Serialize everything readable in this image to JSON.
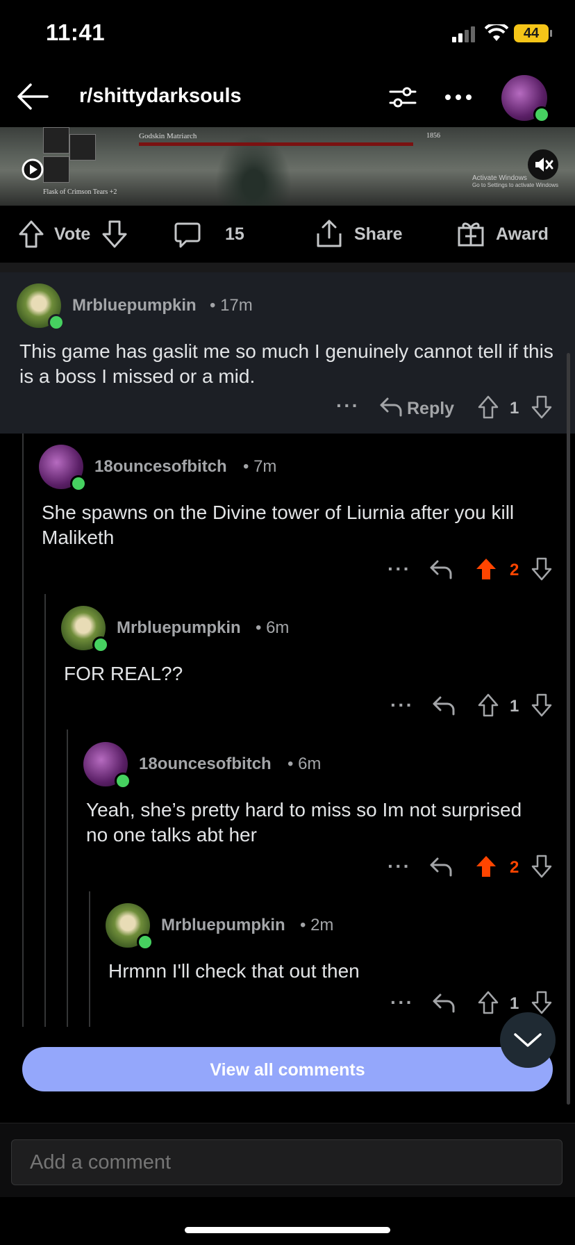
{
  "status_bar": {
    "time": "11:41",
    "battery": "44"
  },
  "header": {
    "subreddit": "r/shittydarksouls"
  },
  "video": {
    "boss_name": "Godskin Matriarch",
    "boss_hp": "1856",
    "flask_label": "Flask of Crimson Tears +2",
    "watermark_line1": "Activate Windows",
    "watermark_line2": "Go to Settings to activate Windows"
  },
  "action_bar": {
    "vote_label": "Vote",
    "comment_count": "15",
    "share_label": "Share",
    "award_label": "Award"
  },
  "comments": [
    {
      "author": "Mrbluepumpkin",
      "age": "17m",
      "body": "This game has gaslit me so much I genuinely cannot tell if this is a boss I missed or a mid.",
      "reply_label": "Reply",
      "score": "1",
      "upvoted": false
    },
    {
      "author": "18ouncesofbitch",
      "age": "7m",
      "body": "She spawns on the Divine tower of Liurnia after you kill Maliketh",
      "score": "2",
      "upvoted": true
    },
    {
      "author": "Mrbluepumpkin",
      "age": "6m",
      "body": "FOR REAL??",
      "score": "1",
      "upvoted": false
    },
    {
      "author": "18ouncesofbitch",
      "age": "6m",
      "body": "Yeah, she’s pretty hard to miss so Im not surprised no one talks abt her",
      "score": "2",
      "upvoted": true
    },
    {
      "author": "Mrbluepumpkin",
      "age": "2m",
      "body": "Hrmnn I'll check that out then",
      "score": "1",
      "upvoted": false
    }
  ],
  "view_all_label": "View all comments",
  "add_comment_placeholder": "Add a comment",
  "colors": {
    "upvote_active": "#ff4500",
    "view_all_button": "#94a7fb",
    "online": "#46d160"
  }
}
